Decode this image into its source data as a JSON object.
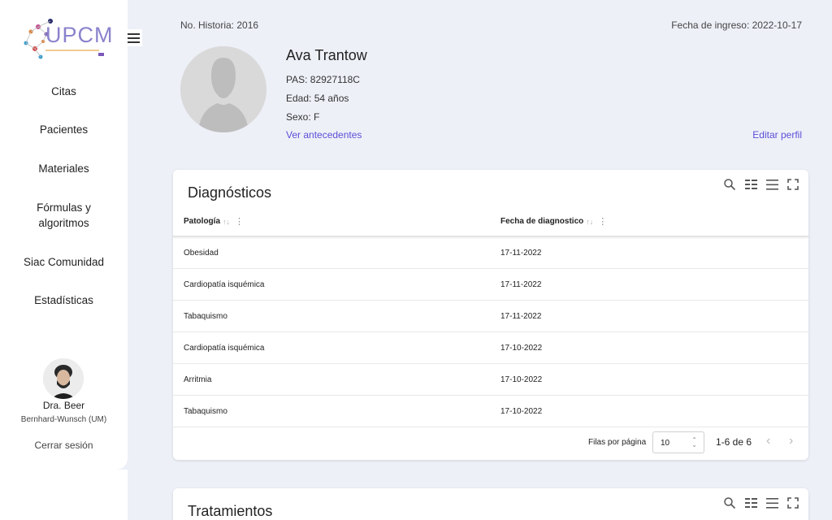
{
  "logo": {
    "text": "UPCM",
    "subtitle": "Unidad de Prevención Cardiometabólica"
  },
  "nav": {
    "items": [
      {
        "label": "Citas"
      },
      {
        "label": "Pacientes"
      },
      {
        "label": "Materiales"
      },
      {
        "label": "Fórmulas y algoritmos"
      },
      {
        "label": "Siac Comunidad"
      },
      {
        "label": "Estadísticas"
      }
    ]
  },
  "user": {
    "name": "Dra. Beer",
    "org": "Bernhard-Wunsch (UM)",
    "logout": "Cerrar sesión"
  },
  "patient": {
    "history": "No. Historia: 2016",
    "admission": "Fecha de ingreso: 2022-10-17",
    "name": "Ava Trantow",
    "pas": "PAS: 82927118C",
    "age": "Edad: 54 años",
    "sex": "Sexo: F",
    "history_link": "Ver antecedentes",
    "edit_link": "Editar perfil"
  },
  "diagnosticos": {
    "title": "Diagnósticos",
    "columns": [
      "Patología",
      "Fecha de diagnostico"
    ],
    "rows": [
      [
        "Obesidad",
        "17-11-2022"
      ],
      [
        "Cardiopatía isquémica",
        "17-11-2022"
      ],
      [
        "Tabaquismo",
        "17-11-2022"
      ],
      [
        "Cardiopatía isquémica",
        "17-10-2022"
      ],
      [
        "Arritmia",
        "17-10-2022"
      ],
      [
        "Tabaquismo",
        "17-10-2022"
      ]
    ],
    "rows_label": "Filas por página",
    "rows_per_page": "10",
    "range": "1-6 de 6"
  },
  "tratamientos": {
    "title": "Tratamientos"
  },
  "colors": {
    "accent": "#5b4fd6",
    "background": "#eef0f8"
  },
  "icons": [
    "menu-icon",
    "search-icon",
    "columns-icon",
    "density-icon",
    "fullscreen-icon",
    "sort-icon",
    "column-menu-icon",
    "chevron-left-icon",
    "chevron-right-icon"
  ]
}
